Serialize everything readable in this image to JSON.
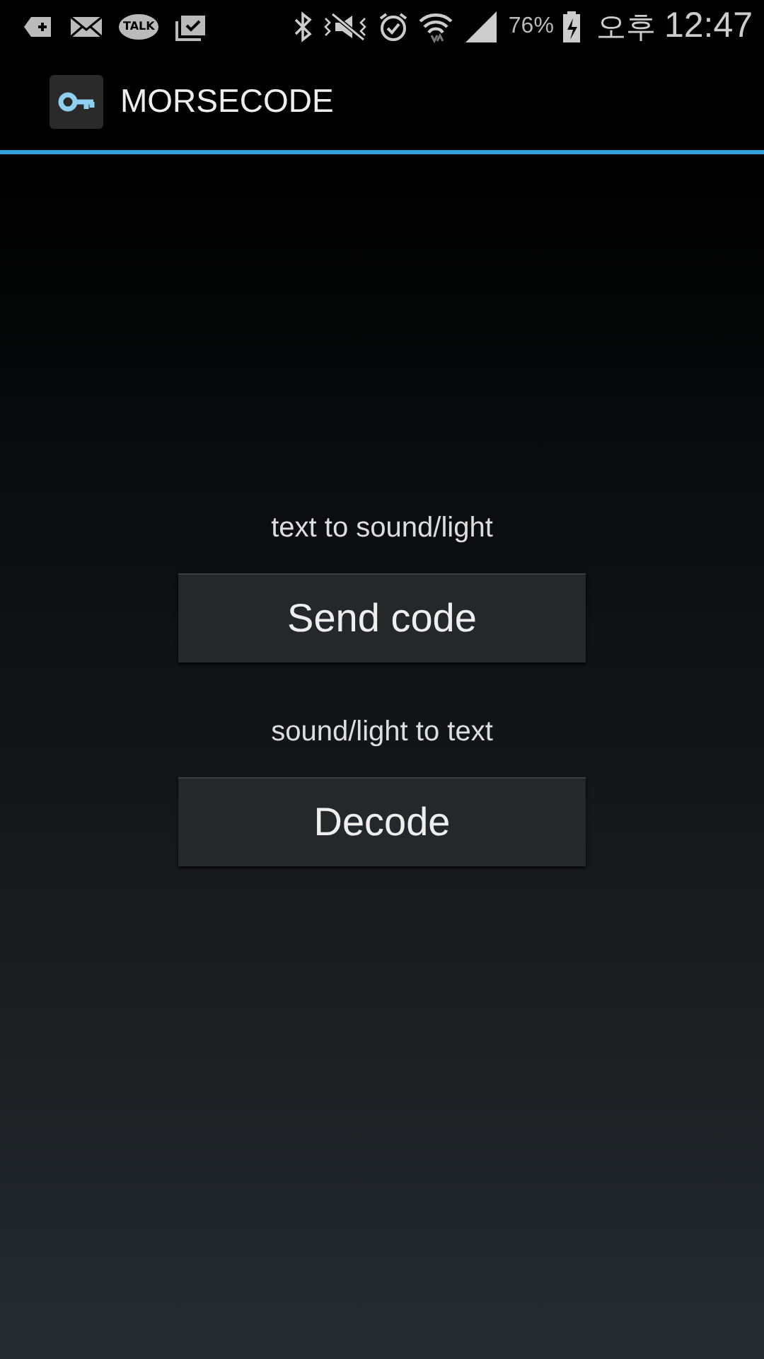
{
  "status_bar": {
    "chat_badge": "TALK",
    "battery": "76%",
    "period": "오후",
    "time": "12:47"
  },
  "action_bar": {
    "title": "MORSECODE"
  },
  "actions": [
    {
      "caption": "text to sound/light",
      "button": "Send code"
    },
    {
      "caption": "sound/light to text",
      "button": "Decode"
    }
  ]
}
